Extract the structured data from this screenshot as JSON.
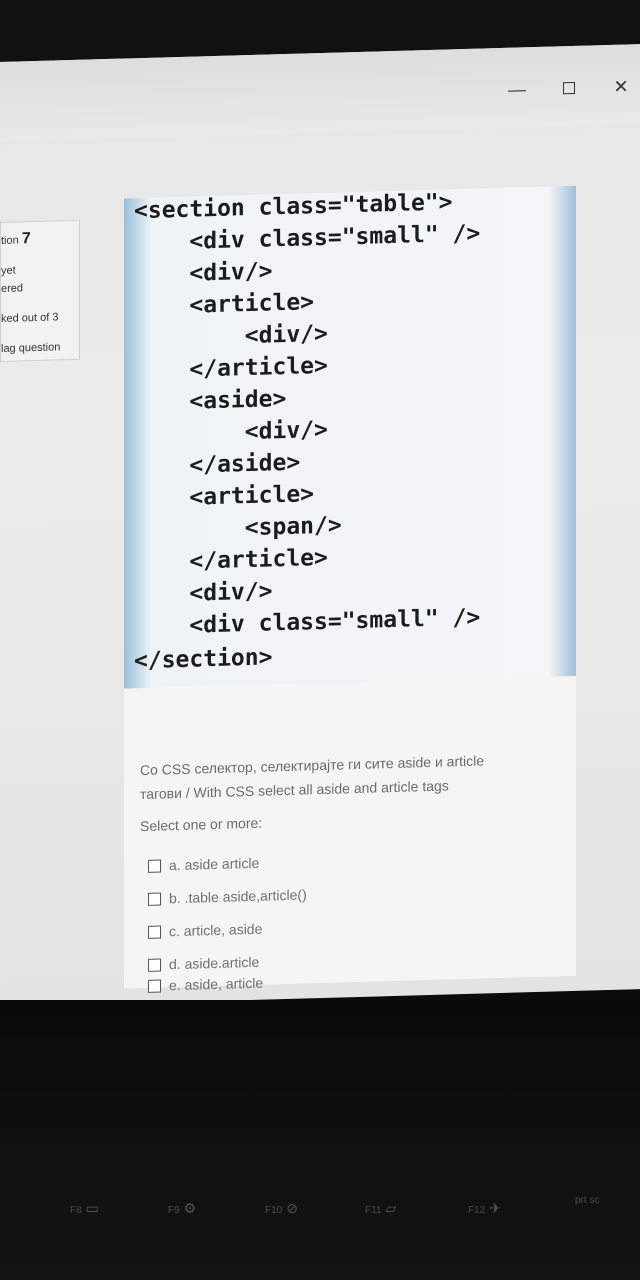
{
  "window": {
    "controls": [
      "—",
      "☐",
      "✕"
    ]
  },
  "sidebar": {
    "question_label": "tion",
    "question_number": "7",
    "status_line1": "yet",
    "status_line2": "ered",
    "marks": "ked out of 3",
    "flag": "lag question"
  },
  "code": {
    "lines": [
      "<section class=\"table\">",
      "    <div class=\"small\" />",
      "    <div/>",
      "    <article>",
      "        <div/>",
      "    </article>",
      "    <aside>",
      "        <div/>",
      "    </aside>",
      "    <article>",
      "        <span/>",
      "    </article>",
      "    <div/>",
      "    <div class=\"small\" />",
      "</section>"
    ]
  },
  "question": {
    "text_mk": "Со CSS селектор, селектирајте ги сите aside и article",
    "text_en": "тагови / With CSS select all aside and article tags",
    "prompt": "Select one or more:",
    "options": [
      "a. aside article",
      "b. .table aside,article()",
      "c. article, aside",
      "d. aside.article",
      "e. aside, article"
    ]
  },
  "keyboard": {
    "keys": [
      "F8",
      "F9",
      "F10",
      "F11",
      "F12",
      "prt sc"
    ]
  }
}
